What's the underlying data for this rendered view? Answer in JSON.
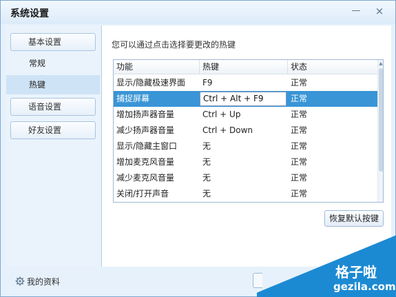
{
  "window": {
    "title": "系统设置",
    "minimize_glyph": "—",
    "close_glyph": "×"
  },
  "sidebar": {
    "groups": [
      {
        "label": "基本设置"
      },
      {
        "label": "语音设置"
      },
      {
        "label": "好友设置"
      }
    ],
    "sub_items": [
      {
        "label": "常规",
        "active": false
      },
      {
        "label": "热键",
        "active": true
      }
    ],
    "profile_label": "我的资料",
    "profile_icon": "gear-icon"
  },
  "main": {
    "hint": "您可以通过点击选择要更改的热键",
    "table": {
      "columns": [
        "功能",
        "热键",
        "状态"
      ],
      "rows": [
        {
          "function": "显示/隐藏极速界面",
          "hotkey": "F9",
          "status": "正常"
        },
        {
          "function": "捕捉屏幕",
          "hotkey": "Ctrl + Alt + F9",
          "status": "正常",
          "selected": true
        },
        {
          "function": "增加扬声器音量",
          "hotkey": "Ctrl + Up",
          "status": "正常"
        },
        {
          "function": "减少扬声器音量",
          "hotkey": "Ctrl + Down",
          "status": "正常"
        },
        {
          "function": "显示/隐藏主窗口",
          "hotkey": "无",
          "status": "正常"
        },
        {
          "function": "增加麦克风音量",
          "hotkey": "无",
          "status": "正常"
        },
        {
          "function": "减少麦克风音量",
          "hotkey": "无",
          "status": "正常"
        },
        {
          "function": "关闭/打开声音",
          "hotkey": "无",
          "status": "正常"
        }
      ]
    },
    "restore_button": "恢复默认按键"
  },
  "watermark": {
    "cn": "格子啦",
    "en": "gezila.com"
  },
  "colors": {
    "accent": "#3a95d6",
    "window_bg": "#e6f1fb",
    "watermark": "#1c8ad3"
  }
}
